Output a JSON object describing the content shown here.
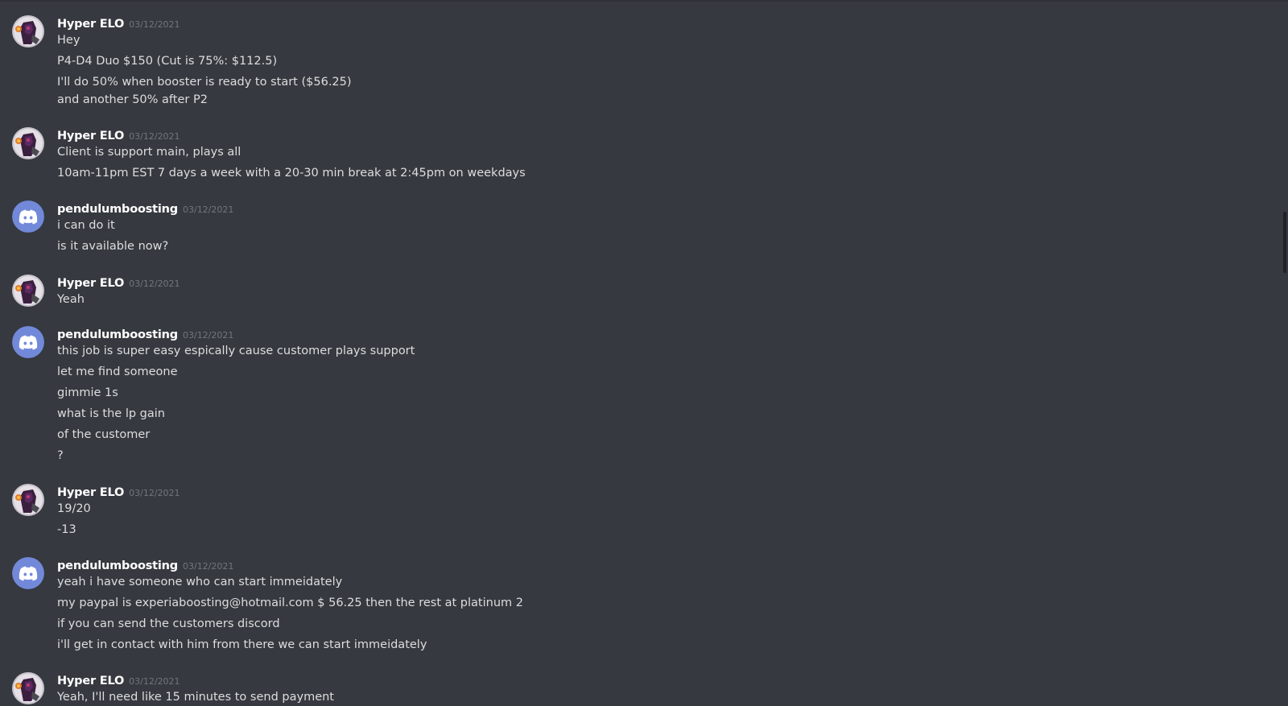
{
  "users": {
    "hyper": {
      "name": "Hyper ELO",
      "avatar_icon": "user-avatar-icon"
    },
    "pendulum": {
      "name": "pendulumboosting",
      "avatar_icon": "discord-logo-icon"
    }
  },
  "colors": {
    "background": "#36393f",
    "username": "#ffffff",
    "text": "#dcddde",
    "timestamp": "#72767d",
    "discord_blurple": "#7289da"
  },
  "messages": [
    {
      "author": "Hyper ELO",
      "timestamp": "03/12/2021",
      "lines": [
        "Hey",
        "P4-D4 Duo $150 (Cut is 75%: $112.5)",
        "I'll do 50% when booster is ready to start ($56.25)",
        "and another 50% after P2"
      ]
    },
    {
      "author": "Hyper ELO",
      "timestamp": "03/12/2021",
      "lines": [
        "Client is support main, plays all",
        "10am-11pm EST 7 days a week with a 20-30 min break at 2:45pm on weekdays"
      ]
    },
    {
      "author": "pendulumboosting",
      "timestamp": "03/12/2021",
      "lines": [
        "i can do it",
        "is it available now?"
      ]
    },
    {
      "author": "Hyper ELO",
      "timestamp": "03/12/2021",
      "lines": [
        "Yeah"
      ]
    },
    {
      "author": "pendulumboosting",
      "timestamp": "03/12/2021",
      "lines": [
        "this job is super easy espically cause customer plays support",
        "let me find someone",
        "gimmie 1s",
        "what is the lp gain",
        "of the customer",
        "?"
      ]
    },
    {
      "author": "Hyper ELO",
      "timestamp": "03/12/2021",
      "lines": [
        "19/20",
        "-13"
      ]
    },
    {
      "author": "pendulumboosting",
      "timestamp": "03/12/2021",
      "lines": [
        "yeah i have someone who can start immeidately",
        "my paypal is experiaboosting@hotmail.com $ 56.25 then the rest at platinum 2",
        "if you can send the customers discord",
        "i'll get in contact with him from there we can start immeidately"
      ]
    },
    {
      "author": "Hyper ELO",
      "timestamp": "03/12/2021",
      "lines": [
        "Yeah, I'll need like 15 minutes to send payment"
      ]
    }
  ]
}
